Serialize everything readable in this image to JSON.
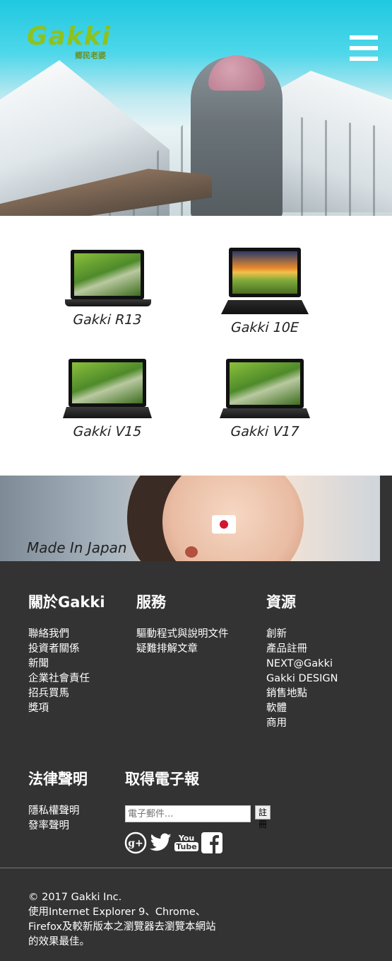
{
  "header": {
    "logo_text": "Gakki",
    "logo_subtitle": "郷民老婆"
  },
  "products": [
    {
      "name": "Gakki R13"
    },
    {
      "name": "Gakki 10E"
    },
    {
      "name": "Gakki V15"
    },
    {
      "name": "Gakki V17"
    }
  ],
  "banner": {
    "caption": "Made In Japan"
  },
  "footer": {
    "about": {
      "title": "關於Gakki",
      "links": [
        "聯絡我們",
        "投資者關係",
        "新聞",
        "企業社會責任",
        "招兵買馬",
        "獎項"
      ]
    },
    "services": {
      "title": "服務",
      "links": [
        "驅動程式與說明文件",
        "疑難排解文章"
      ]
    },
    "resources": {
      "title": "資源",
      "links": [
        "創新",
        "產品註冊",
        "NEXT@Gakki",
        "Gakki DESIGN",
        "銷售地點",
        "軟體",
        "商用"
      ]
    },
    "legal": {
      "title": "法律聲明",
      "links": [
        "隱私權聲明",
        "發率聲明"
      ]
    },
    "newsletter": {
      "title": "取得電子報",
      "placeholder": "電子郵件...",
      "button": "註冊"
    },
    "social": {
      "icons": [
        "google-plus-icon",
        "twitter-icon",
        "youtube-icon",
        "facebook-icon"
      ],
      "youtube_top": "You",
      "youtube_bottom": "Tube"
    },
    "copyright": "© 2017 Gakki Inc.",
    "browser_note_1": "使用Internet Explorer 9、Chrome、",
    "browser_note_2": "Firefox及較新版本之瀏覽器去瀏覽本網站",
    "browser_note_3": "的效果最佳。"
  }
}
